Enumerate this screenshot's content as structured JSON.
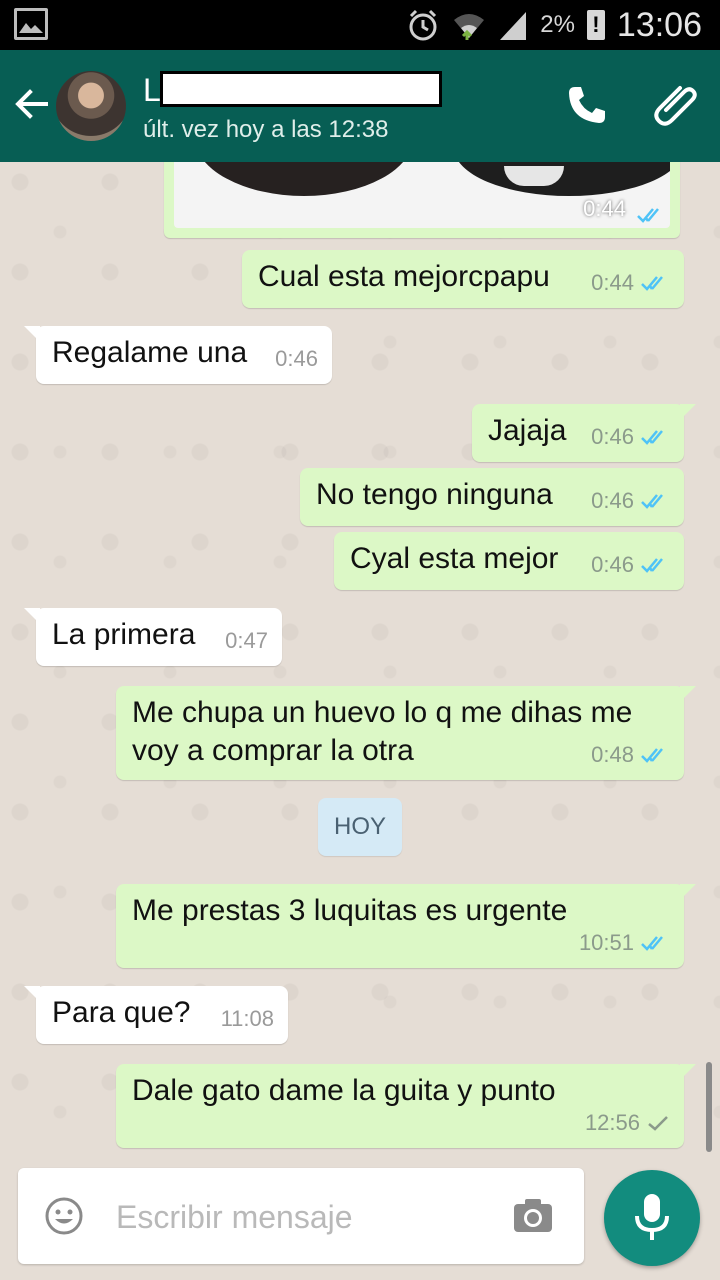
{
  "status_bar": {
    "battery": "2%",
    "time": "13:06"
  },
  "header": {
    "contact_name": "L",
    "last_seen": "últ. vez hoy a las 12:38"
  },
  "messages": [
    {
      "dir": "out",
      "text": "",
      "time": "0:44",
      "status": "read",
      "type": "image"
    },
    {
      "dir": "out",
      "text": "Cual esta mejorcpapu",
      "time": "0:44",
      "status": "read"
    },
    {
      "dir": "in",
      "text": "Regalame una",
      "time": "0:46"
    },
    {
      "dir": "out",
      "text": "Jajaja",
      "time": "0:46",
      "status": "read"
    },
    {
      "dir": "out",
      "text": "No tengo ninguna",
      "time": "0:46",
      "status": "read"
    },
    {
      "dir": "out",
      "text": "Cyal esta mejor",
      "time": "0:46",
      "status": "read"
    },
    {
      "dir": "in",
      "text": "La primera",
      "time": "0:47"
    },
    {
      "dir": "out",
      "text": "Me chupa un huevo lo q me dihas me voy a comprar la otra",
      "time": "0:48",
      "status": "read"
    },
    {
      "dir": "out",
      "text": "Me prestas 3 luquitas es urgente",
      "time": "10:51",
      "status": "read"
    },
    {
      "dir": "in",
      "text": "Para que?",
      "time": "11:08"
    },
    {
      "dir": "out",
      "text": "Dale gato dame la guita y punto",
      "time": "12:56",
      "status": "sent"
    }
  ],
  "date_chip": "HOY",
  "composer": {
    "placeholder": "Escribir mensaje"
  },
  "colors": {
    "header": "#075e54",
    "outgoing_bubble": "#dcf8c6",
    "incoming_bubble": "#ffffff",
    "read_ticks": "#4fc3f7",
    "mic_button": "#128c7e"
  }
}
